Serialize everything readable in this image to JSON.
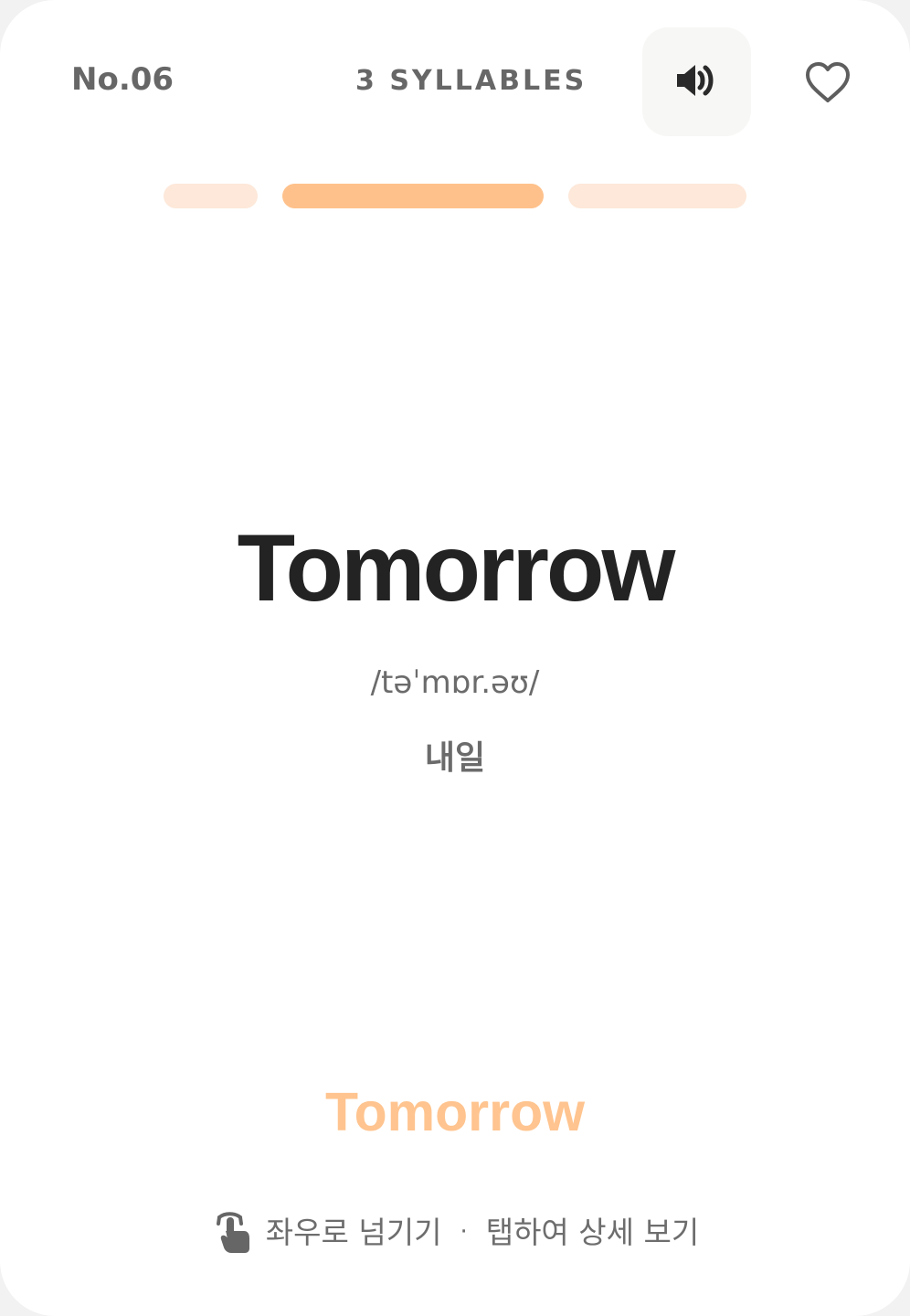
{
  "header": {
    "card_number": "No.06",
    "syllables": "3 SYLLABLES"
  },
  "icons": {
    "speaker": "speaker-icon",
    "favorite": "heart-outline-icon",
    "swipe_hint": "tap-hand-icon"
  },
  "progress": {
    "segment_count": 3,
    "active_index": 2,
    "colors": {
      "active": "#ffc18b",
      "inactive": "#fde8d9"
    }
  },
  "card": {
    "word": "Tomorrow",
    "phonetic": "/təˈmɒr.əʊ/",
    "meaning": "내일",
    "footer_word": "Tomorrow"
  },
  "hint": {
    "swipe_text": "좌우로 넘기기",
    "separator": "·",
    "tap_text": "탭하여 상세 보기"
  },
  "colors": {
    "background": "#ffffff",
    "primary_text": "#232323",
    "secondary_text": "#676767",
    "accent": "#ffc18b",
    "faded_accent": "#ffc48f"
  }
}
